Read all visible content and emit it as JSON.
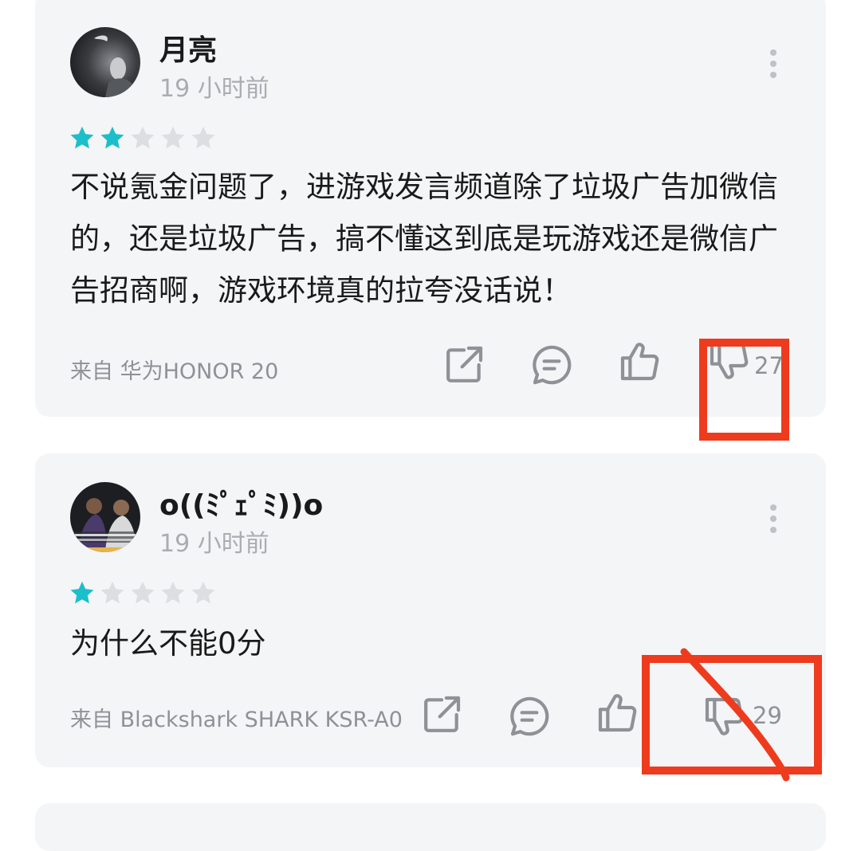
{
  "reviews": [
    {
      "username": "月亮",
      "time": "19 小时前",
      "rating": 2,
      "max_rating": 5,
      "content": "不说氪金问题了，进游戏发言频道除了垃圾广告加微信的，还是垃圾广告，搞不懂这到底是玩游戏还是微信广告招商啊，游戏环境真的拉夸没话说！",
      "device": "来自 华为HONOR 20",
      "dislike_count": "27"
    },
    {
      "username": "o((ﾐﾟｪﾟﾐ))o",
      "time": "19 小时前",
      "rating": 1,
      "max_rating": 5,
      "content": "为什么不能0分",
      "device": "来自 Blackshark SHARK KSR-A0",
      "dislike_count": "29"
    }
  ],
  "colors": {
    "star_filled": "#1bbfca",
    "star_empty": "#dcdee1",
    "annotation_red": "#ee3b1e",
    "card_bg": "#f4f5f7"
  },
  "icons": [
    "share-icon",
    "comment-icon",
    "thumbs-up-icon",
    "thumbs-down-icon",
    "more-vertical-icon"
  ]
}
